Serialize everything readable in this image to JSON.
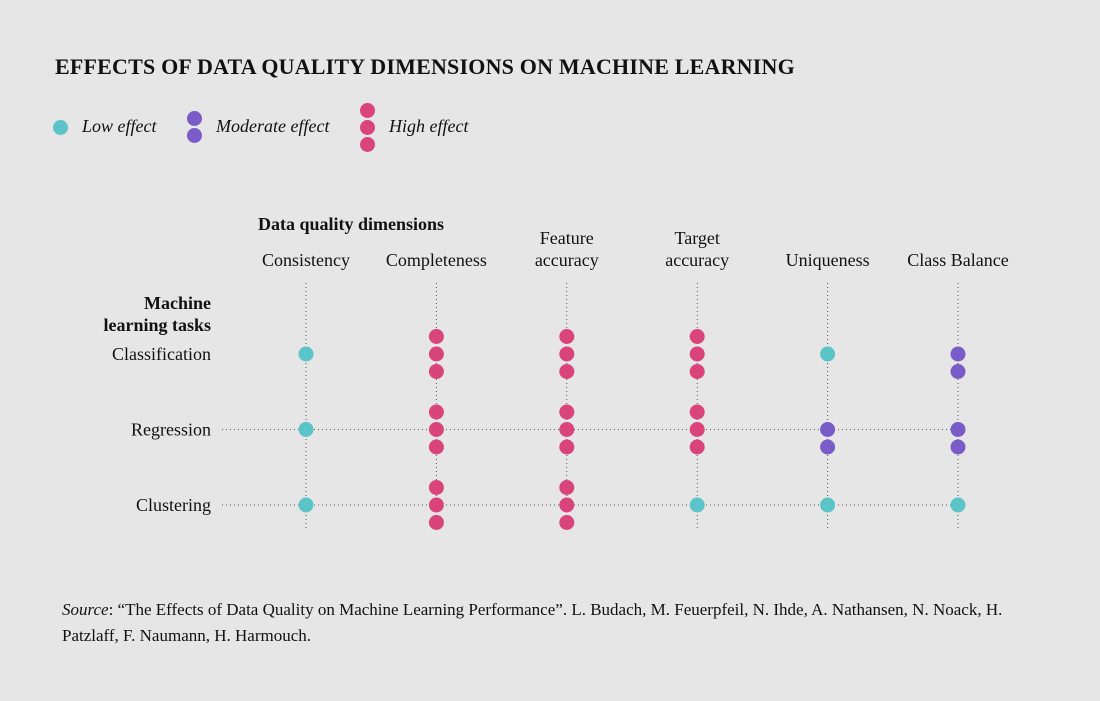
{
  "title": "EFFECTS OF DATA QUALITY DIMENSIONS ON MACHINE LEARNING",
  "legend": [
    {
      "key": "low",
      "label": "Low effect",
      "dots": 1,
      "color": "#5bc4c9"
    },
    {
      "key": "moderate",
      "label": "Moderate effect",
      "dots": 2,
      "color": "#7a5cc9"
    },
    {
      "key": "high",
      "label": "High effect",
      "dots": 3,
      "color": "#d9457b"
    }
  ],
  "chart_data": {
    "type": "dot-matrix",
    "title": "EFFECTS OF DATA QUALITY DIMENSIONS ON MACHINE LEARNING",
    "column_axis_title": "Data quality dimensions",
    "row_axis_title": [
      "Machine",
      "learning tasks"
    ],
    "columns": [
      [
        "Consistency"
      ],
      [
        "Completeness"
      ],
      [
        "Feature",
        "accuracy"
      ],
      [
        "Target",
        "accuracy"
      ],
      [
        "Uniqueness"
      ],
      [
        "Class Balance"
      ]
    ],
    "rows": [
      "Classification",
      "Regression",
      "Clustering"
    ],
    "scale": {
      "1": "Low effect",
      "2": "Moderate effect",
      "3": "High effect"
    },
    "colors": {
      "1": "#5bc4c9",
      "2": "#7a5cc9",
      "3": "#d9457b"
    },
    "values": [
      [
        1,
        3,
        3,
        3,
        1,
        2
      ],
      [
        1,
        3,
        3,
        3,
        2,
        2
      ],
      [
        1,
        3,
        3,
        1,
        1,
        1
      ]
    ],
    "grid_line_color": "#555555"
  },
  "source": {
    "key": "Source",
    "text": ": “The Effects of Data Quality on Machine Learning Performance”. L. Budach, M. Feuerpfeil, N. Ihde, A. Nathansen, N. Noack, H. Patzlaff, F. Naumann, H. Harmouch."
  }
}
